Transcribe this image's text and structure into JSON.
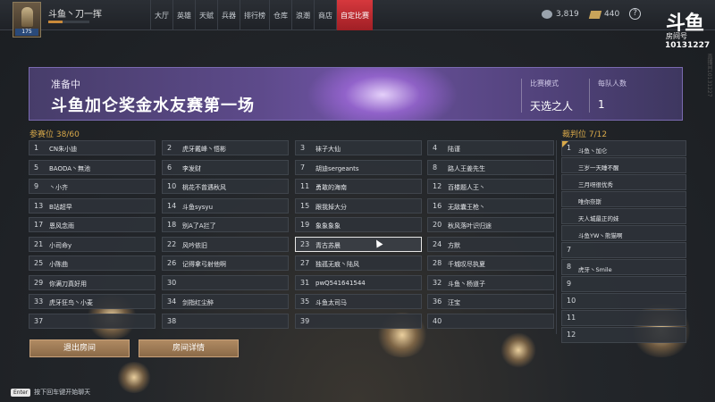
{
  "player": {
    "name": "斗鱼丶刀一挥",
    "level": "175",
    "exp_fraction": 0.35
  },
  "nav": [
    "大厅",
    "英雄",
    "天赋",
    "兵器",
    "排行榜",
    "仓库",
    "浪潮",
    "商店",
    "自定比赛"
  ],
  "nav_active_index": 8,
  "currency": {
    "silver": "3,819",
    "gold": "440"
  },
  "douyu": {
    "logo": "斗鱼",
    "room_label": "房间号",
    "room_number": "10131227"
  },
  "watermark": "直播间10131227",
  "banner": {
    "status": "准备中",
    "title": "斗鱼加仑奖金水友赛第一场",
    "mode_label": "比赛模式",
    "mode_value": "天选之人",
    "team_label": "每队人数",
    "team_value": "1"
  },
  "participants": {
    "label": "参赛位",
    "count": "38/60",
    "slots": [
      [
        "1",
        "CN朱小迪"
      ],
      [
        "2",
        "虎牙戴峰丶悟彬"
      ],
      [
        "3",
        "袜子大仙"
      ],
      [
        "4",
        "陆谨"
      ],
      [
        "5",
        "BAODA丶無池"
      ],
      [
        "6",
        "李发财"
      ],
      [
        "7",
        "胡迪sergeants"
      ],
      [
        "8",
        "路人王姜先生"
      ],
      [
        "9",
        "丶小齐"
      ],
      [
        "10",
        "桃花不曾遇秋风"
      ],
      [
        "11",
        "勇敢的海南"
      ],
      [
        "12",
        "百楼题人王丶"
      ],
      [
        "13",
        "B站超早"
      ],
      [
        "14",
        "斗鱼sysyu"
      ],
      [
        "15",
        "跟我掉大分"
      ],
      [
        "16",
        "无敌囊王枪丶"
      ],
      [
        "17",
        "恩风念雨"
      ],
      [
        "18",
        "别A了A拦了"
      ],
      [
        "19",
        "象象象象"
      ],
      [
        "20",
        "秋风落叶识归途"
      ],
      [
        "21",
        "小司命y"
      ],
      [
        "22",
        "风吟依旧"
      ],
      [
        "23",
        "青古苏晨"
      ],
      [
        "24",
        "方默"
      ],
      [
        "25",
        "小陈曲"
      ],
      [
        "26",
        "记得拿弓射他啊"
      ],
      [
        "27",
        "独孤无痕丶陆风"
      ],
      [
        "28",
        "千城叹尽执夏"
      ],
      [
        "29",
        "你满刀真好用"
      ],
      [
        "30",
        ""
      ],
      [
        "31",
        "pwQ541641544"
      ],
      [
        "32",
        "斗鱼丶杨道子"
      ],
      [
        "33",
        "虎牙狂鸟丶小麦"
      ],
      [
        "34",
        "剑指红尘醉"
      ],
      [
        "35",
        "斗鱼太司马"
      ],
      [
        "36",
        "汪宝"
      ],
      [
        "37",
        ""
      ],
      [
        "38",
        ""
      ],
      [
        "39",
        ""
      ],
      [
        "40",
        ""
      ]
    ],
    "highlight_index": 22
  },
  "referees": {
    "label": "裁判位",
    "count": "7/12",
    "slots": [
      [
        "1",
        "斗鱼丶加仑"
      ],
      [
        "",
        "三岁一天睡不醒"
      ],
      [
        "",
        "三月呀很优秀"
      ],
      [
        "",
        "唯你奈斯"
      ],
      [
        "",
        "天人城最正的妹"
      ],
      [
        "",
        "斗鱼YW丶熊猫啊"
      ],
      [
        "7",
        ""
      ],
      [
        "8",
        "虎牙丶Smile"
      ],
      [
        "9",
        ""
      ],
      [
        "10",
        ""
      ],
      [
        "11",
        ""
      ],
      [
        "12",
        ""
      ]
    ]
  },
  "buttons": {
    "leave": "退出房间",
    "details": "房间详情"
  },
  "chat": {
    "key": "Enter",
    "hint": "按下回车键开始聊天"
  }
}
